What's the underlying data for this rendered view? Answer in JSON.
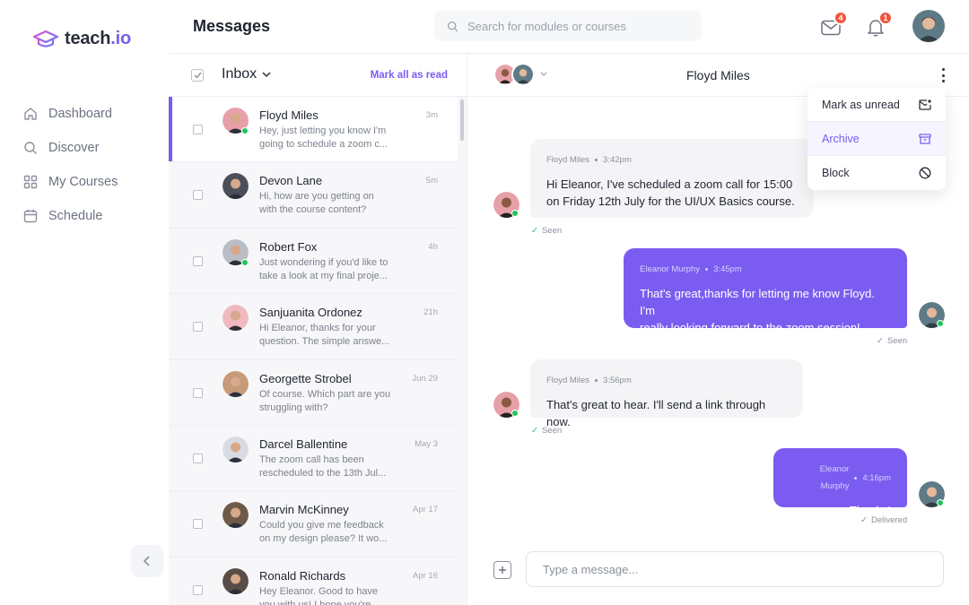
{
  "app": {
    "logo_text": "teach",
    "logo_suffix": ".io",
    "accent": "#7b5cf0"
  },
  "nav": [
    {
      "label": "Dashboard",
      "icon": "home-icon"
    },
    {
      "label": "Discover",
      "icon": "search-icon"
    },
    {
      "label": "My Courses",
      "icon": "grid-icon"
    },
    {
      "label": "Schedule",
      "icon": "calendar-icon"
    }
  ],
  "header": {
    "title": "Messages",
    "search_placeholder": "Search for modules or courses",
    "mail_badge": "4",
    "bell_badge": "1"
  },
  "inbox": {
    "title": "Inbox",
    "mark_all": "Mark all as read",
    "conversations": [
      {
        "name": "Floyd Miles",
        "time": "3m",
        "preview": "Hey, just letting you know I'm going to schedule a zoom c...",
        "online": true,
        "active": true,
        "color": "#e8a0a8"
      },
      {
        "name": "Devon Lane",
        "time": "5m",
        "preview": "Hi, how are you getting on with the course content?",
        "online": false,
        "active": false,
        "color": "#4a4f5a"
      },
      {
        "name": "Robert Fox",
        "time": "4h",
        "preview": "Just wondering if you'd like to take a look at my final proje...",
        "online": true,
        "active": false,
        "color": "#b9bec6"
      },
      {
        "name": "Sanjuanita Ordonez",
        "time": "21h",
        "preview": "Hi Eleanor, thanks for your question. The simple answe...",
        "online": false,
        "active": false,
        "color": "#f0b9c0"
      },
      {
        "name": "Georgette Strobel",
        "time": "Jun 29",
        "preview": "Of course. Which part are you struggling with?",
        "online": false,
        "active": false,
        "color": "#c79a7a"
      },
      {
        "name": "Darcel Ballentine",
        "time": "May 3",
        "preview": "The zoom call has been rescheduled to the 13th Jul...",
        "online": false,
        "active": false,
        "color": "#d8dce2"
      },
      {
        "name": "Marvin McKinney",
        "time": "Apr 17",
        "preview": "Could you give me feedback on my design please? It wo...",
        "online": false,
        "active": false,
        "color": "#6f5a4a"
      },
      {
        "name": "Ronald Richards",
        "time": "Apr 16",
        "preview": "Hey Eleanor. Good to have you with us! I hope you're...",
        "online": false,
        "active": false,
        "color": "#5a4c46"
      }
    ]
  },
  "chat": {
    "title": "Floyd Miles",
    "menu": [
      {
        "label": "Mark as unread",
        "icon": "mail-unread-icon"
      },
      {
        "label": "Archive",
        "icon": "archive-icon"
      },
      {
        "label": "Block",
        "icon": "block-icon"
      }
    ],
    "messages": [
      {
        "sender": "Floyd Miles",
        "time": "3:42pm",
        "text_line1": "Hi Eleanor, I've scheduled a zoom call for 15:00",
        "text_line2": "on Friday 12th July for the UI/UX Basics course.",
        "status": "Seen"
      },
      {
        "sender": "Eleanor Murphy",
        "time": "3:45pm",
        "text_line1": "That's great,thanks for letting me know Floyd. I'm",
        "text_line2": "really looking forward to the zoom session!",
        "status": "Seen"
      },
      {
        "sender": "Floyd Miles",
        "time": "3:56pm",
        "text_line1": "That's great to hear. I'll send a link through now.",
        "text_line2": "",
        "status": "Seen"
      },
      {
        "sender": "Eleanor Murphy",
        "time": "4:16pm",
        "text_line1": "Thanks!",
        "text_line2": "",
        "status": "Delivered"
      }
    ],
    "composer_placeholder": "Type a message..."
  }
}
